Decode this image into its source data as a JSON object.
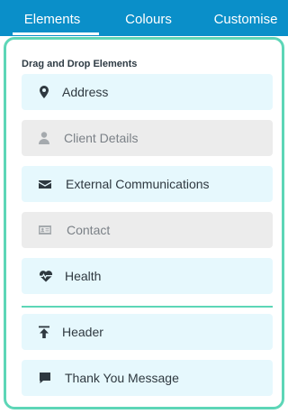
{
  "tabs": [
    {
      "label": "Elements",
      "active": true
    },
    {
      "label": "Colours",
      "active": false
    },
    {
      "label": "Customise",
      "active": false
    }
  ],
  "panel": {
    "heading": "Drag and Drop Elements",
    "border_color": "#5dd6b7",
    "items": [
      {
        "label": "Address",
        "icon": "map-marker-icon",
        "state": "enabled"
      },
      {
        "label": "Client Details",
        "icon": "user-icon",
        "state": "disabled"
      },
      {
        "label": "External Communications",
        "icon": "envelope-icon",
        "state": "enabled"
      },
      {
        "label": "Contact",
        "icon": "id-card-icon",
        "state": "disabled"
      },
      {
        "label": "Health",
        "icon": "heartbeat-icon",
        "state": "enabled"
      }
    ],
    "layout_items": [
      {
        "label": "Header",
        "icon": "arrow-to-top-icon",
        "state": "enabled"
      },
      {
        "label": "Thank You Message",
        "icon": "comment-icon",
        "state": "enabled"
      }
    ]
  },
  "colors": {
    "tab_bar": "#0a8fc9",
    "item_enabled_bg": "#e6f8fd",
    "item_disabled_bg": "#ececec"
  }
}
